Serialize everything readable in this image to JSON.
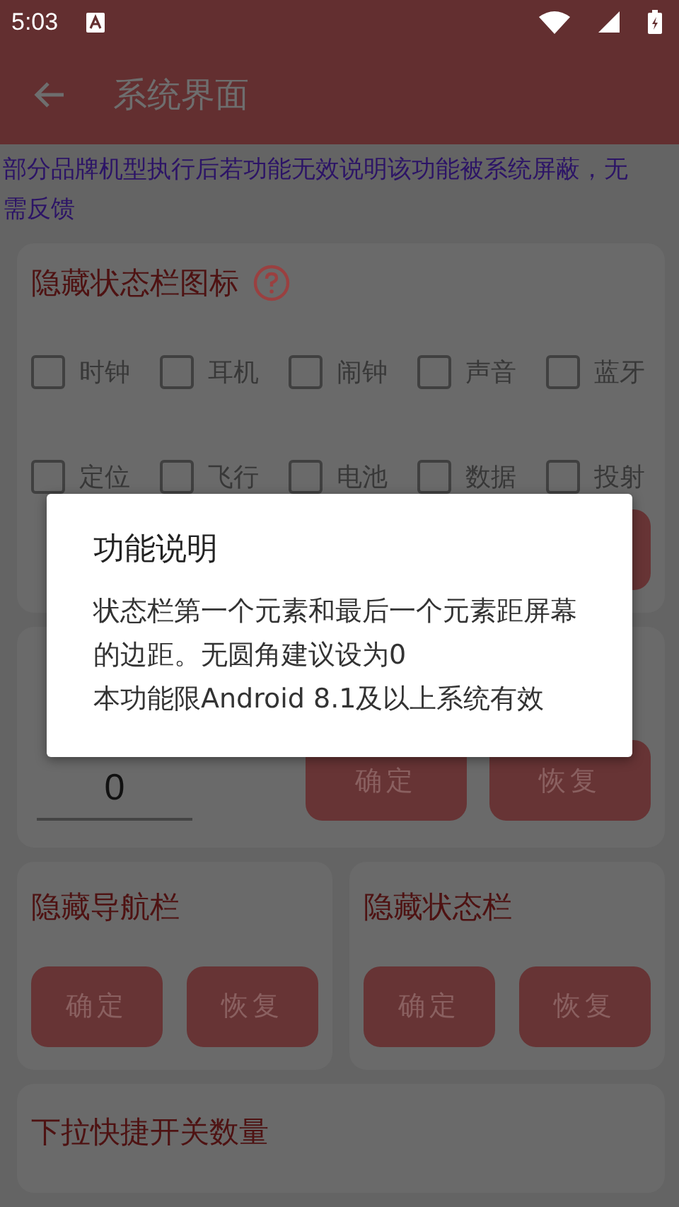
{
  "status_bar": {
    "time": "5:03"
  },
  "app_bar": {
    "title": "系统界面"
  },
  "notice": "部分品牌机型执行后若功能无效说明该功能被系统屏蔽，无需反馈",
  "icon_card": {
    "title": "隐藏状态栏图标",
    "checkboxes": [
      {
        "label": "时钟",
        "checked": false
      },
      {
        "label": "耳机",
        "checked": false
      },
      {
        "label": "闹钟",
        "checked": false
      },
      {
        "label": "声音",
        "checked": false
      },
      {
        "label": "蓝牙",
        "checked": false
      },
      {
        "label": "定位",
        "checked": false
      },
      {
        "label": "飞行",
        "checked": false
      },
      {
        "label": "电池",
        "checked": false
      },
      {
        "label": "数据",
        "checked": false
      },
      {
        "label": "投射",
        "checked": false
      }
    ]
  },
  "margin_card": {
    "value": "0",
    "buttons": [
      "确定",
      "恢复"
    ]
  },
  "pair_cards": [
    {
      "title": "隐藏导航栏",
      "buttons": [
        "确定",
        "恢复"
      ]
    },
    {
      "title": "隐藏状态栏",
      "buttons": [
        "确定",
        "恢复"
      ]
    }
  ],
  "bottom_card": {
    "title": "下拉快捷开关数量"
  },
  "dialog": {
    "title": "功能说明",
    "paragraphs": [
      "状态栏第一个元素和最后一个元素距屏幕的边距。无圆角建议设为0",
      "本功能限Android 8.1及以上系统有效"
    ]
  }
}
